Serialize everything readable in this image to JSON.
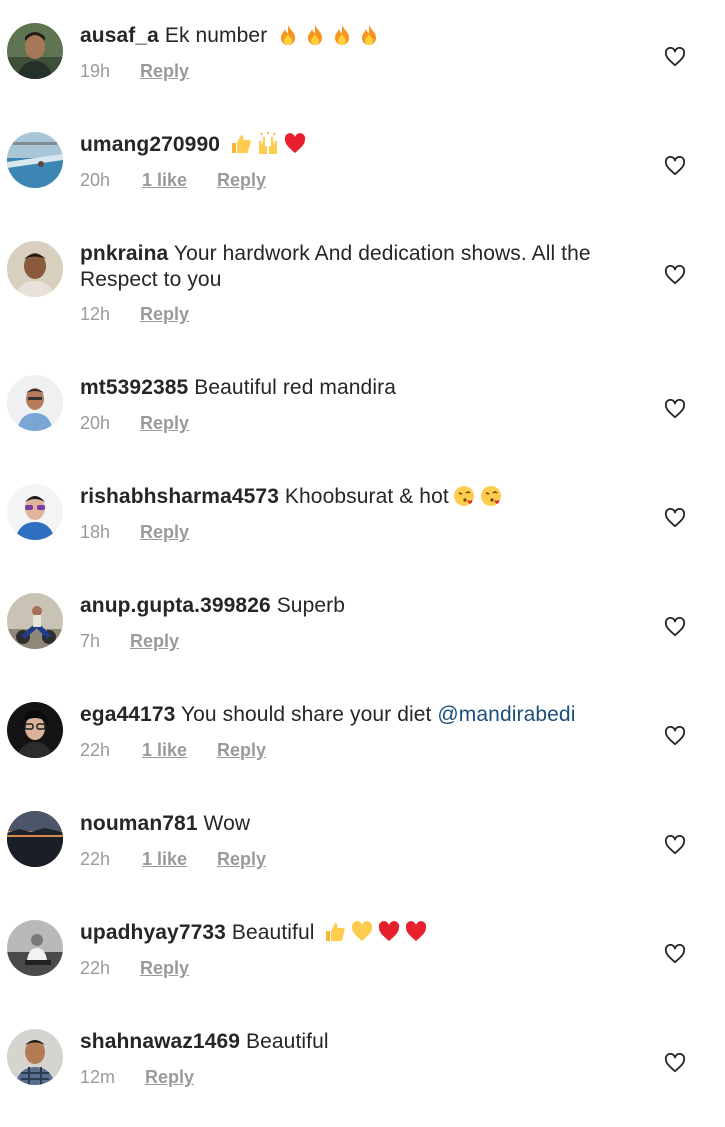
{
  "comments": [
    {
      "username": "ausaf_a",
      "text": "Ek number",
      "mention": "",
      "emojis": [
        "fire",
        "fire",
        "fire",
        "fire"
      ],
      "time": "19h",
      "likes": "",
      "reply": "Reply",
      "avatar": "avatar-man-green"
    },
    {
      "username": "umang270990",
      "text": "",
      "mention": "",
      "emojis": [
        "thumbs-up",
        "raised-hands",
        "red-heart"
      ],
      "time": "20h",
      "likes": "1 like",
      "reply": "Reply",
      "avatar": "avatar-pool"
    },
    {
      "username": "pnkraina",
      "text": "Your hardwork And dedication shows. All the Respect to you",
      "mention": "",
      "emojis": [],
      "time": "12h",
      "likes": "",
      "reply": "Reply",
      "avatar": "avatar-man-beige"
    },
    {
      "username": "mt5392385",
      "text": "Beautiful red mandira",
      "mention": "",
      "emojis": [],
      "time": "20h",
      "likes": "",
      "reply": "Reply",
      "avatar": "avatar-man-blue"
    },
    {
      "username": "rishabhsharma4573",
      "text": "Khoobsurat & hot",
      "mention": "",
      "emojis": [
        "kiss-face",
        "kiss-face"
      ],
      "time": "18h",
      "likes": "",
      "reply": "Reply",
      "avatar": "avatar-man-sunglasses"
    },
    {
      "username": "anup.gupta.399826",
      "text": "Superb",
      "mention": "",
      "emojis": [],
      "time": "7h",
      "likes": "",
      "reply": "Reply",
      "avatar": "avatar-motorbike"
    },
    {
      "username": "ega44173",
      "text": "You should share your diet",
      "mention": "@mandirabedi",
      "emojis": [],
      "time": "22h",
      "likes": "1 like",
      "reply": "Reply",
      "avatar": "avatar-woman-dark"
    },
    {
      "username": "nouman781",
      "text": "Wow",
      "mention": "",
      "emojis": [],
      "time": "22h",
      "likes": "1 like",
      "reply": "Reply",
      "avatar": "avatar-sunset"
    },
    {
      "username": "upadhyay7733",
      "text": "Beautiful",
      "mention": "",
      "emojis": [
        "thumbs-up",
        "yellow-heart",
        "red-heart",
        "red-heart"
      ],
      "time": "22h",
      "likes": "",
      "reply": "Reply",
      "avatar": "avatar-bw"
    },
    {
      "username": "shahnawaz1469",
      "text": "Beautiful",
      "mention": "",
      "emojis": [],
      "time": "12m",
      "likes": "",
      "reply": "Reply",
      "avatar": "avatar-man-plaid"
    }
  ],
  "icons": {
    "like": "heart-outline-icon"
  },
  "colors": {
    "text": "#262626",
    "meta": "#9a9a9a",
    "mention": "#1d4e7a"
  }
}
